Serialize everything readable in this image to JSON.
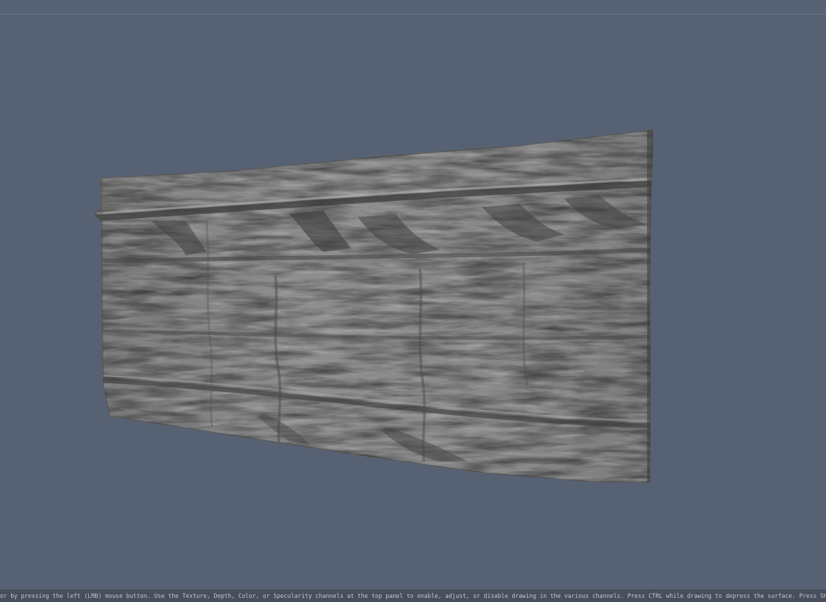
{
  "viewport": {
    "background_color": "#566274",
    "object": "rock-wall-sculpt-mesh",
    "mesh_color": "#8c8c8c"
  },
  "status_bar": {
    "hint_text": "or by pressing the left (LMB) mouse button. Use the Texture, Depth, Color, or Specularity channels at the top panel to enable, adjust, or disable drawing in the various channels. Press CTRL while drawing to depress the surface. Press SHIFT to smooth the active channel(s) while you draw. Navigate the camera with"
  }
}
